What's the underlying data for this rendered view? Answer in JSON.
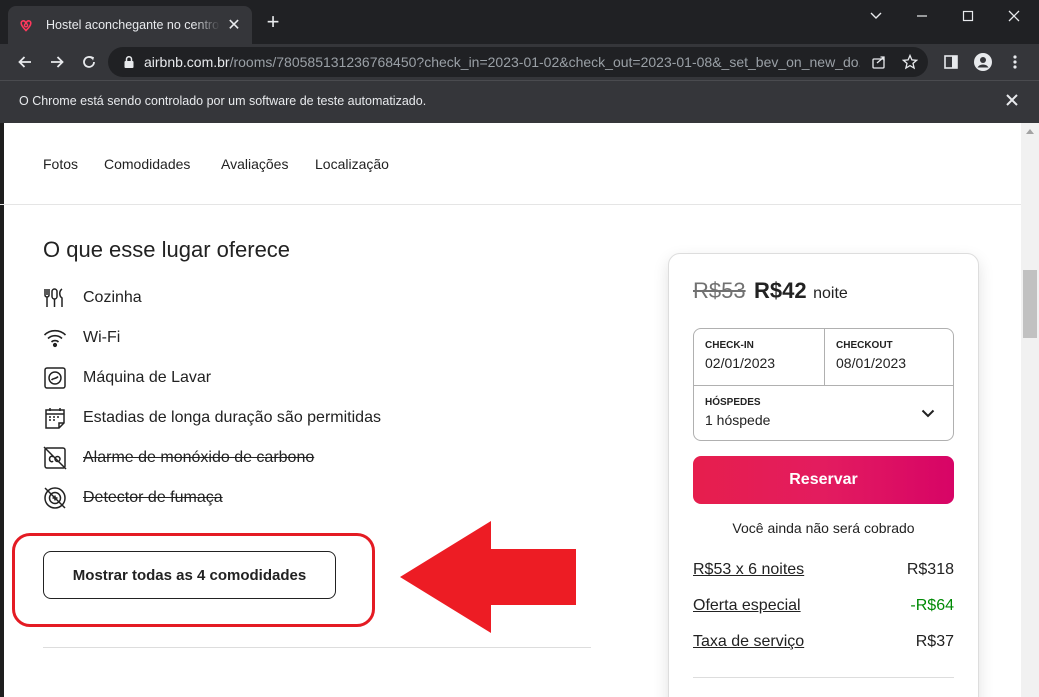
{
  "browser": {
    "tab_title": "Hostel aconchegante no centro histórico",
    "url_host": "airbnb.com.br",
    "url_path": "/rooms/780585131236768450?check_in=2023-01-02&check_out=2023-01-08&_set_bev_on_new_do...",
    "infobar_text": "O Chrome está sendo controlado por um software de teste automatizado.",
    "accent_color": "#ff385c"
  },
  "subnav": {
    "items": [
      "Fotos",
      "Comodidades",
      "Avaliações",
      "Localização"
    ]
  },
  "amenities": {
    "title": "O que esse lugar oferece",
    "items": [
      {
        "label": "Cozinha",
        "icon": "kitchen-icon",
        "available": true
      },
      {
        "label": "Wi-Fi",
        "icon": "wifi-icon",
        "available": true
      },
      {
        "label": "Máquina de Lavar",
        "icon": "washer-icon",
        "available": true
      },
      {
        "label": "Estadias de longa duração são permitidas",
        "icon": "calendar-icon",
        "available": true
      },
      {
        "label": "Alarme de monóxido de carbono",
        "icon": "co-alarm-icon",
        "available": false
      },
      {
        "label": "Detector de fumaça",
        "icon": "smoke-detector-icon",
        "available": false
      }
    ],
    "show_all_label": "Mostrar todas as 4 comodidades"
  },
  "booking": {
    "old_price": "R$53",
    "price": "R$42",
    "per": "noite",
    "checkin_label": "CHECK-IN",
    "checkin_value": "02/01/2023",
    "checkout_label": "CHECKOUT",
    "checkout_value": "08/01/2023",
    "guests_label": "HÓSPEDES",
    "guests_value": "1 hóspede",
    "reserve_label": "Reservar",
    "no_charge_note": "Você ainda não será cobrado",
    "fees": [
      {
        "label": "R$53 x 6 noites",
        "value": "R$318",
        "discount": false
      },
      {
        "label": "Oferta especial",
        "value": "-R$64",
        "discount": true
      },
      {
        "label": "Taxa de serviço",
        "value": "R$37",
        "discount": false
      }
    ]
  }
}
